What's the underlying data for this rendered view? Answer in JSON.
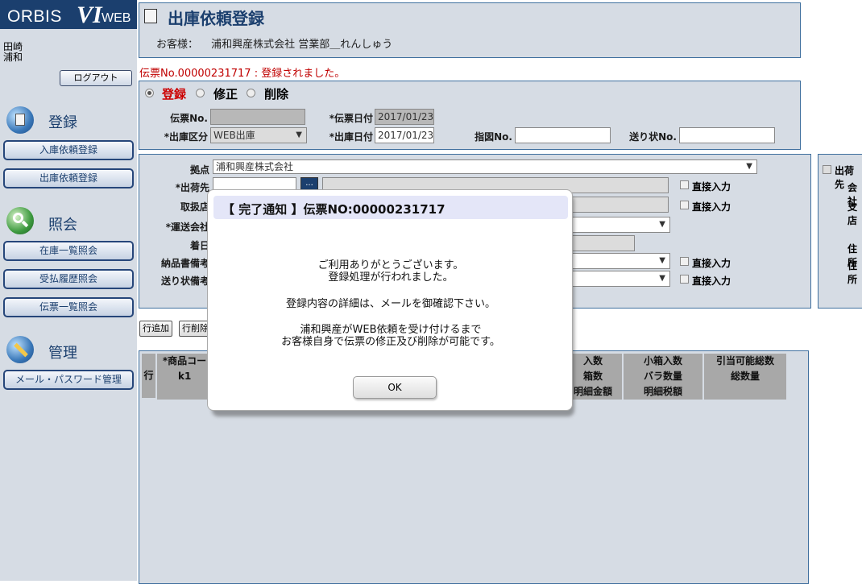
{
  "app": {
    "logo_left": "ORBIS",
    "logo_mark": "VI",
    "logo_right": "WEB"
  },
  "user": {
    "name": "田崎",
    "branch": "浦和"
  },
  "sidebar": {
    "logout_label": "ログアウト",
    "sections": [
      {
        "label": "登録",
        "icon": "register-icon",
        "buttons": [
          "入庫依頼登録",
          "出庫依頼登録"
        ]
      },
      {
        "label": "照会",
        "icon": "search-icon",
        "buttons": [
          "在庫一覧照会",
          "受払履歴照会",
          "伝票一覧照会"
        ]
      },
      {
        "label": "管理",
        "icon": "wrench-icon",
        "buttons": [
          "メール・パスワード管理"
        ]
      }
    ]
  },
  "header": {
    "title": "出庫依頼登録",
    "customer_label": "お客様：",
    "customer_value": "浦和興産株式会社 営業部＿れんしゅう"
  },
  "message": "伝票No.00000231717 : 登録されました。",
  "modes": [
    {
      "label": "登録",
      "selected": true,
      "color": "#cc0000"
    },
    {
      "label": "修正",
      "selected": false,
      "color": "#000000"
    },
    {
      "label": "削除",
      "selected": false,
      "color": "#000000"
    }
  ],
  "form_top": {
    "slip_no_label": "伝票No.",
    "slip_no_value": "",
    "slip_date_label": "*伝票日付",
    "slip_date_value": "2017/01/23",
    "ship_type_label": "*出庫区分",
    "ship_type_value": "WEB出庫",
    "ship_date_label": "*出庫日付",
    "ship_date_value": "2017/01/23",
    "sashizu_label": "指図No.",
    "sashizu_value": "",
    "okurijo_label": "送り状No.",
    "okurijo_value": ""
  },
  "form_mid": {
    "base_label": "拠点",
    "base_value": "浦和興産株式会社",
    "dest_label": "*出荷先",
    "dealer_label": "取扱店",
    "carrier_label": "*運送会社",
    "arrival_label": "着日",
    "delivery_note_label": "納品書備考",
    "invoice_note_label": "送り状備考",
    "direct_input_label": "直接入力",
    "lookup_button": "..."
  },
  "right_panel": {
    "ship_label": "出荷先",
    "company_label": "会社",
    "branch_label": "支店",
    "address1_label": "住所",
    "address2_label": "住所"
  },
  "grid_actions": {
    "add_row": "行追加",
    "delete_row": "行削除"
  },
  "grid": {
    "row_header": "行",
    "col1_top": "*商品コード",
    "col1_mid": "k1",
    "cols": [
      {
        "top": "入数",
        "mid": "箱数",
        "bot": "明細金額"
      },
      {
        "top": "小箱入数",
        "mid": "バラ数量",
        "bot": "明細税額"
      },
      {
        "top": "引当可能総数",
        "mid": "総数量",
        "bot": ""
      }
    ]
  },
  "modal": {
    "title": "【 完了通知 】伝票NO:00000231717",
    "line1": "ご利用ありがとうございます。",
    "line2": "登録処理が行われました。",
    "line3": "登録内容の詳細は、メールを御確認下さい。",
    "line4": "浦和興産がWEB依頼を受け付けるまで",
    "line5": "お客様自身で伝票の修正及び削除が可能です。",
    "ok_label": "OK"
  }
}
